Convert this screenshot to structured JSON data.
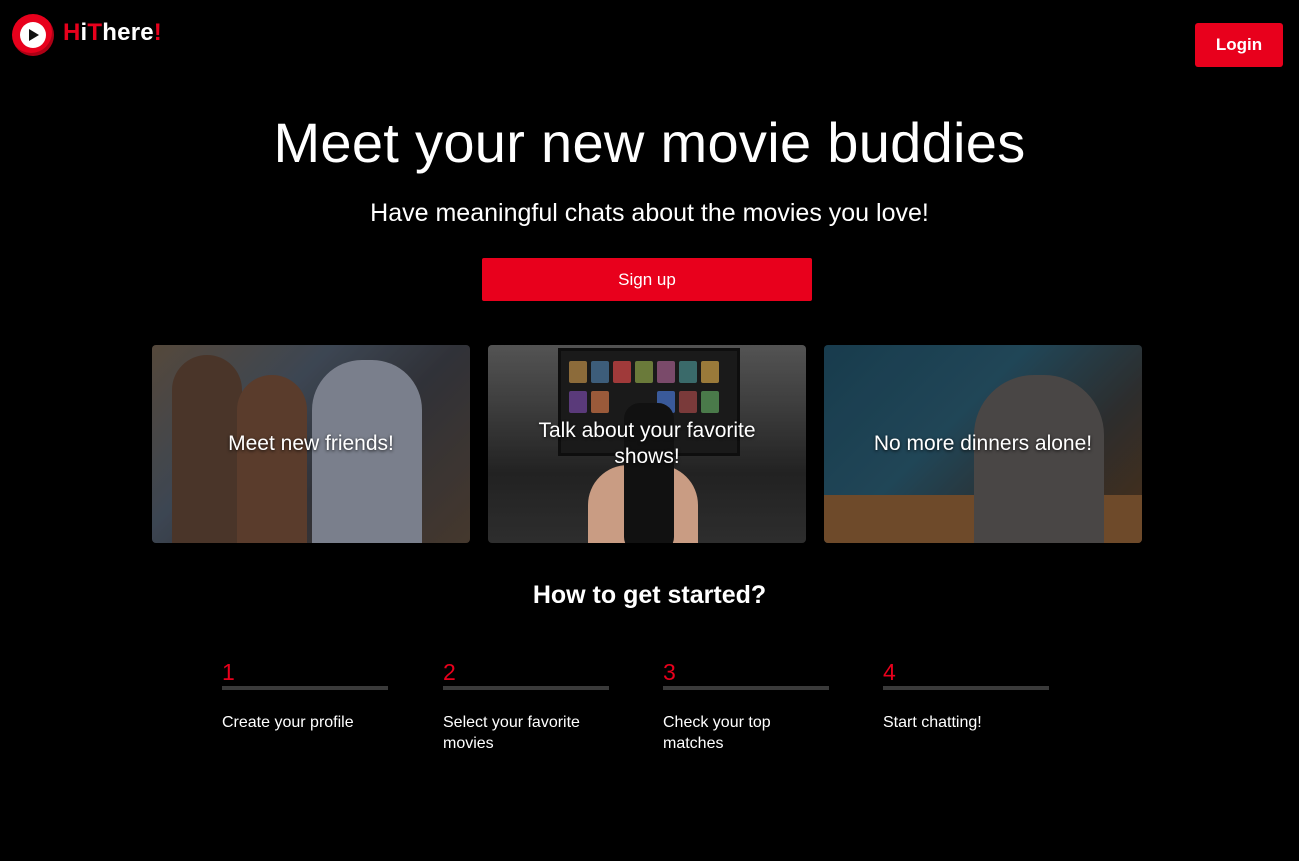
{
  "brand": {
    "name_parts": [
      "H",
      "i",
      "T",
      "here",
      "!"
    ],
    "accent_color": "#e8001c"
  },
  "header": {
    "login_label": "Login"
  },
  "hero": {
    "title": "Meet your new movie buddies",
    "subtitle": "Have meaningful chats about the movies you love!",
    "signup_label": "Sign up"
  },
  "cards": [
    {
      "label": "Meet new friends!"
    },
    {
      "label": "Talk about your favorite shows!"
    },
    {
      "label": "No more dinners alone!"
    }
  ],
  "how_to": {
    "title": "How to get started?",
    "steps": [
      {
        "number": "1",
        "text": "Create your profile"
      },
      {
        "number": "2",
        "text": "Select your favorite movies"
      },
      {
        "number": "3",
        "text": "Check your top matches"
      },
      {
        "number": "4",
        "text": "Start chatting!"
      }
    ]
  }
}
